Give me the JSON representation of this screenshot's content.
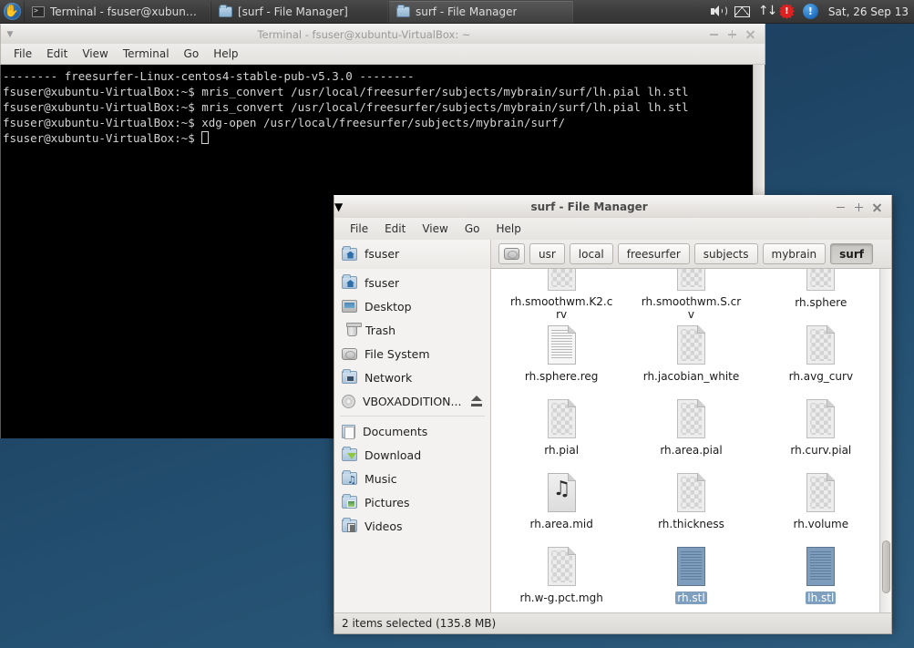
{
  "taskbar": {
    "launcher_icon": "xubuntu-mouse-logo",
    "tasks": [
      {
        "icon": "terminal-icon",
        "label": "Terminal - fsuser@xubuntu-...",
        "state": "flat"
      },
      {
        "icon": "folder-icon",
        "label": "[surf - File Manager]",
        "state": "flat"
      },
      {
        "icon": "folder-icon",
        "label": "surf - File Manager",
        "state": "raised"
      }
    ],
    "tray": {
      "volume_icon": "speaker-icon",
      "mail_icon": "mail-icon",
      "network_icon": "network-up-down-icon",
      "update_icon": "alert-star-icon",
      "info_icon": "info-circle-icon",
      "clock": "Sat, 26 Sep  13"
    }
  },
  "terminal": {
    "title": "Terminal - fsuser@xubuntu-VirtualBox: ~",
    "menus": [
      "File",
      "Edit",
      "View",
      "Terminal",
      "Go",
      "Help"
    ],
    "lines": [
      "-------- freesurfer-Linux-centos4-stable-pub-v5.3.0 --------",
      "fsuser@xubuntu-VirtualBox:~$ mris_convert /usr/local/freesurfer/subjects/mybrain/surf/lh.pial lh.stl",
      "fsuser@xubuntu-VirtualBox:~$ mris_convert /usr/local/freesurfer/subjects/mybrain/surf/lh.pial lh.stl",
      "fsuser@xubuntu-VirtualBox:~$ xdg-open /usr/local/freesurfer/subjects/mybrain/surf/"
    ],
    "prompt": "fsuser@xubuntu-VirtualBox:~$ ",
    "window_buttons": {
      "minimize": "minimize-icon",
      "maximize": "maximize-icon",
      "close": "close-icon"
    }
  },
  "file_manager": {
    "title": "surf - File Manager",
    "menus": [
      "File",
      "Edit",
      "View",
      "Go",
      "Help"
    ],
    "shortcut_header": {
      "icon": "home-folder-icon",
      "label": "fsuser"
    },
    "breadcrumbs": [
      {
        "label": "",
        "icon": "filesystem-icon",
        "active": false
      },
      {
        "label": "usr",
        "active": false
      },
      {
        "label": "local",
        "active": false
      },
      {
        "label": "freesurfer",
        "active": false
      },
      {
        "label": "subjects",
        "active": false
      },
      {
        "label": "mybrain",
        "active": false
      },
      {
        "label": "surf",
        "active": true
      }
    ],
    "sidebar": {
      "group1": [
        {
          "label": "fsuser",
          "icon": "home-icon"
        },
        {
          "label": "Desktop",
          "icon": "desktop-icon"
        },
        {
          "label": "Trash",
          "icon": "trash-icon"
        },
        {
          "label": "File System",
          "icon": "harddisk-icon"
        },
        {
          "label": "Network",
          "icon": "network-icon"
        },
        {
          "label": "VBOXADDITION...",
          "icon": "cdrom-icon",
          "eject": true
        }
      ],
      "group2": [
        {
          "label": "Documents",
          "icon": "documents-folder-icon"
        },
        {
          "label": "Download",
          "icon": "download-folder-icon"
        },
        {
          "label": "Music",
          "icon": "music-folder-icon"
        },
        {
          "label": "Pictures",
          "icon": "pictures-folder-icon"
        },
        {
          "label": "Videos",
          "icon": "videos-folder-icon"
        }
      ]
    },
    "files": [
      {
        "name": "rh.smoothwm.K2.crv",
        "icon": "checker-file-icon",
        "selected": false,
        "clipped": true
      },
      {
        "name": "rh.smoothwm.S.crv",
        "icon": "checker-file-icon",
        "selected": false,
        "clipped": true
      },
      {
        "name": "rh.sphere",
        "icon": "checker-file-icon",
        "selected": false,
        "clipped": true
      },
      {
        "name": "rh.sphere.reg",
        "icon": "text-file-icon",
        "selected": false
      },
      {
        "name": "rh.jacobian_white",
        "icon": "checker-file-icon",
        "selected": false
      },
      {
        "name": "rh.avg_curv",
        "icon": "checker-file-icon",
        "selected": false
      },
      {
        "name": "rh.pial",
        "icon": "checker-file-icon",
        "selected": false
      },
      {
        "name": "rh.area.pial",
        "icon": "checker-file-icon",
        "selected": false
      },
      {
        "name": "rh.curv.pial",
        "icon": "checker-file-icon",
        "selected": false
      },
      {
        "name": "rh.area.mid",
        "icon": "music-file-icon",
        "selected": false
      },
      {
        "name": "rh.thickness",
        "icon": "checker-file-icon",
        "selected": false
      },
      {
        "name": "rh.volume",
        "icon": "checker-file-icon",
        "selected": false
      },
      {
        "name": "rh.w-g.pct.mgh",
        "icon": "checker-file-icon",
        "selected": false
      },
      {
        "name": "rh.stl",
        "icon": "text-file-icon",
        "selected": true
      },
      {
        "name": "lh.stl",
        "icon": "text-file-icon",
        "selected": true
      }
    ],
    "status": "2 items selected (135.8 MB)",
    "window_buttons": {
      "minimize": "minimize-icon",
      "maximize": "maximize-icon",
      "close": "close-icon"
    }
  },
  "colors": {
    "desktop": "#20486b",
    "taskbar": "#3c3c3c",
    "selection": "#7f9fbf",
    "terminal_bg": "#000000",
    "terminal_fg": "#d4d4d4"
  }
}
